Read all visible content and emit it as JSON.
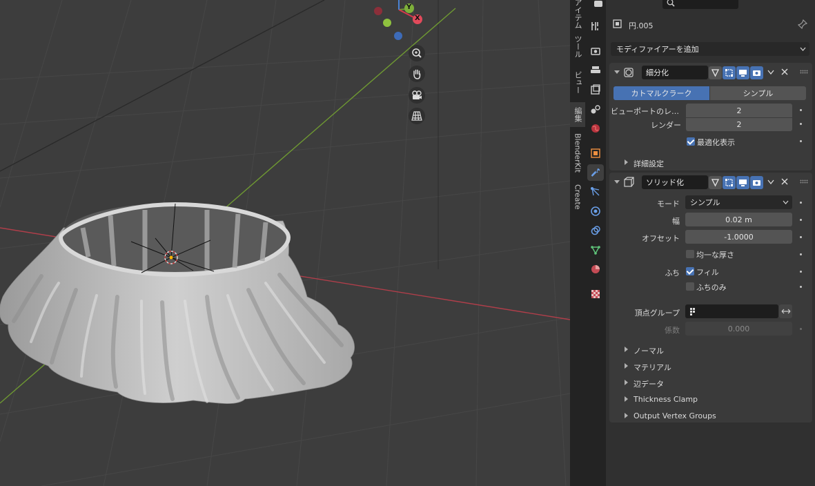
{
  "viewport": {
    "gizmo": {
      "y_label": "Y",
      "x_label": "X"
    },
    "colors": {
      "x_axis": "#b03e4a",
      "y_axis": "#6f9a32",
      "background": "#3d3d3d"
    }
  },
  "sidebar_tabs": [
    "アイテム",
    "ツール",
    "ビュー",
    "編集",
    "BlenderKit",
    "Create"
  ],
  "header": {
    "object_name": "円.005",
    "add_modifier": "モディファイアーを追加"
  },
  "modifiers": {
    "subsurf": {
      "name": "細分化",
      "mode_tabs": [
        "カトマルクラーク",
        "シンプル"
      ],
      "viewport_label": "ビューポートのレ…",
      "viewport_value": "2",
      "render_label": "レンダー",
      "render_value": "2",
      "optimal_label": "最適化表示",
      "advanced_label": "詳細設定"
    },
    "solidify": {
      "name": "ソリッド化",
      "mode_label": "モード",
      "mode_value": "シンプル",
      "thickness_label": "幅",
      "thickness_value": "0.02 m",
      "offset_label": "オフセット",
      "offset_value": "-1.0000",
      "even_label": "均一な厚さ",
      "rim_label": "ふち",
      "fill_label": "フィル",
      "rim_only_label": "ふちのみ",
      "vgroup_label": "頂点グループ",
      "factor_label": "係数",
      "factor_value": "0.000",
      "subpanels": [
        "ノーマル",
        "マテリアル",
        "辺データ",
        "Thickness Clamp",
        "Output Vertex Groups"
      ]
    }
  },
  "accent": "#4772b3"
}
